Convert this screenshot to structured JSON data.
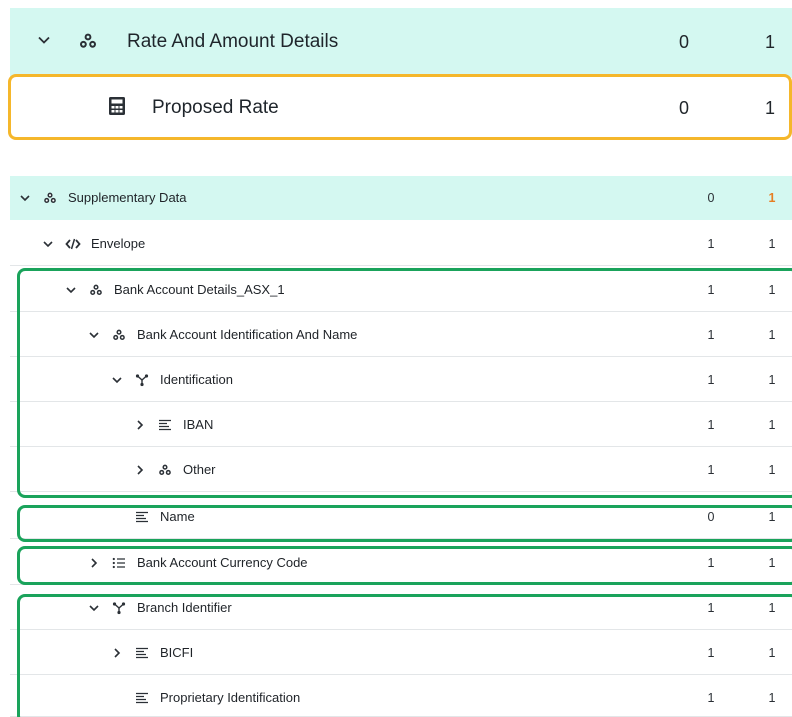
{
  "top_panel": {
    "rows": [
      {
        "label": "Rate And Amount Details",
        "col1": "0",
        "col2": "1",
        "icon": "group-icon",
        "expander": "chevron-down-icon"
      },
      {
        "label": "Proposed Rate",
        "col1": "0",
        "col2": "1",
        "icon": "calculator-icon"
      }
    ]
  },
  "tree": {
    "rows": [
      {
        "label": "Supplementary Data",
        "col1": "0",
        "col2": "1",
        "icon": "group-icon",
        "expander": "chevron-down-icon",
        "col2_color": "#e67e22"
      },
      {
        "label": "Envelope",
        "col1": "1",
        "col2": "1",
        "icon": "code-icon",
        "expander": "chevron-down-icon"
      },
      {
        "label": "Bank Account Details_ASX_1",
        "col1": "1",
        "col2": "1",
        "icon": "group-icon",
        "expander": "chevron-down-icon"
      },
      {
        "label": "Bank Account Identification And Name",
        "col1": "1",
        "col2": "1",
        "icon": "group-icon",
        "expander": "chevron-down-icon"
      },
      {
        "label": "Identification",
        "col1": "1",
        "col2": "1",
        "icon": "choice-icon",
        "expander": "chevron-down-icon"
      },
      {
        "label": "IBAN",
        "col1": "1",
        "col2": "1",
        "icon": "text-lines-icon",
        "expander": "chevron-right-icon"
      },
      {
        "label": "Other",
        "col1": "1",
        "col2": "1",
        "icon": "group-icon",
        "expander": "chevron-right-icon"
      },
      {
        "label": "Name",
        "col1": "0",
        "col2": "1",
        "icon": "text-lines-icon"
      },
      {
        "label": "Bank Account Currency Code",
        "col1": "1",
        "col2": "1",
        "icon": "list-icon",
        "expander": "chevron-right-icon"
      },
      {
        "label": "Branch Identifier",
        "col1": "1",
        "col2": "1",
        "icon": "choice-icon",
        "expander": "chevron-down-icon"
      },
      {
        "label": "BICFI",
        "col1": "1",
        "col2": "1",
        "icon": "text-lines-icon",
        "expander": "chevron-right-icon"
      },
      {
        "label": "Proprietary Identification",
        "col1": "1",
        "col2": "1",
        "icon": "text-lines-icon"
      }
    ]
  },
  "colors": {
    "header_bg": "#d4f8f1",
    "selected_border": "#f5b72b",
    "highlight_border": "#1aa35b",
    "accent_orange": "#e67e22"
  }
}
